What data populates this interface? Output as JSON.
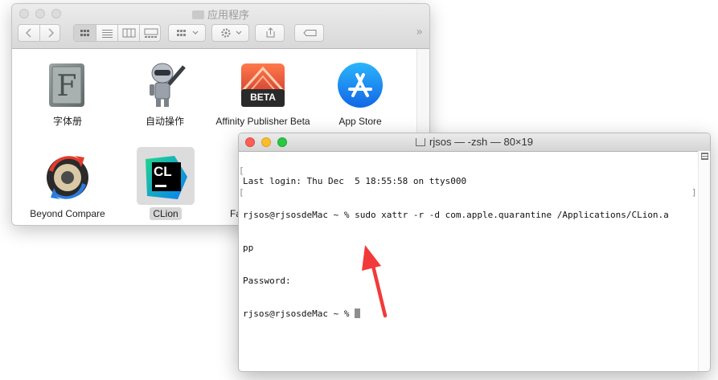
{
  "finder": {
    "title": "应用程序",
    "more_glyph": "»",
    "apps": [
      {
        "label": "字体册",
        "icon": "font-book-icon"
      },
      {
        "label": "自动操作",
        "icon": "automator-robot-icon"
      },
      {
        "label": "Affinity Publisher Beta",
        "icon": "affinity-publisher-icon",
        "badge": "BETA"
      },
      {
        "label": "App Store",
        "icon": "app-store-icon"
      },
      {
        "label": "Beyond Compare",
        "icon": "beyond-compare-icon"
      },
      {
        "label": "CLion",
        "icon": "clion-icon",
        "badge": "CL",
        "selected": true
      },
      {
        "label": "Fa",
        "icon": "partial-app-icon"
      }
    ]
  },
  "terminal": {
    "title": "rjsos — -zsh — 80×19",
    "lines": [
      "Last login: Thu Dec  5 18:55:58 on ttys000",
      "rjsos@rjsosdeMac ~ % sudo xattr -r -d com.apple.quarantine /Applications/CLion.a",
      "pp",
      "Password:",
      "rjsos@rjsosdeMac ~ % "
    ]
  },
  "colors": {
    "annotation_arrow": "#f23a3a",
    "traffic_red": "#fc5f57",
    "traffic_yellow": "#fdbc2e",
    "traffic_green": "#28c840"
  }
}
